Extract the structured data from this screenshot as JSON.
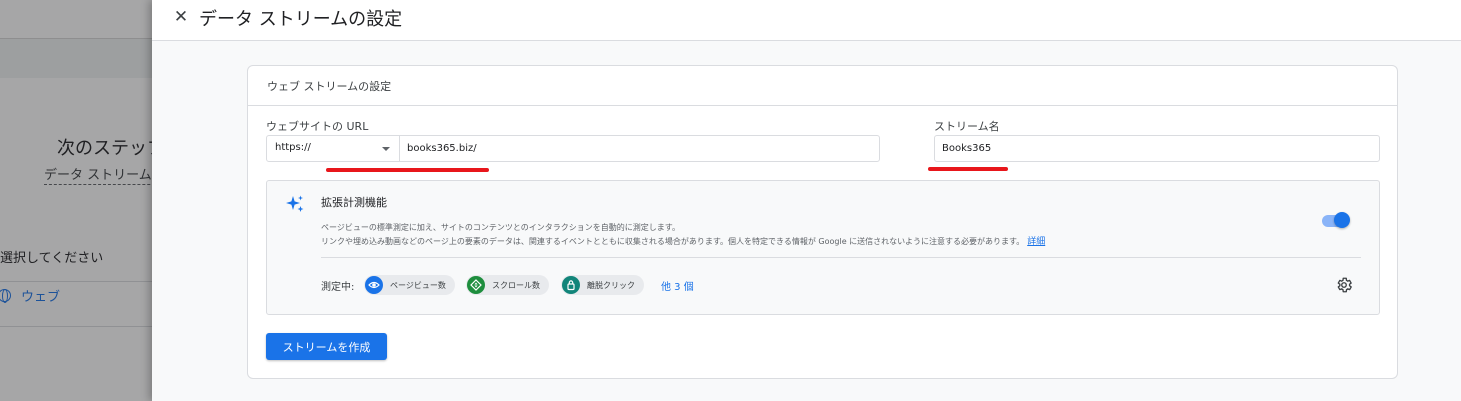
{
  "background": {
    "next_step": "次のステップ",
    "stream_prompt": "データ ストリームを",
    "select_prompt": "選択してください",
    "web_label": "ウェブ"
  },
  "drawer": {
    "close_glyph": "✕",
    "title": "データ ストリームの設定"
  },
  "card": {
    "title": "ウェブ ストリームの設定",
    "url_label": "ウェブサイトの URL",
    "protocol": "https://",
    "url_value": "books365.biz/",
    "stream_name_label": "ストリーム名",
    "stream_name_value": "Books365"
  },
  "enhanced": {
    "title": "拡張計測機能",
    "desc_line1": "ページビューの標準測定に加え、サイトのコンテンツとのインタラクションを自動的に測定します。",
    "desc_line2": "リンクや埋め込み動画などのページ上の要素のデータは、関連するイベントとともに収集される場合があります。個人を特定できる情報が Google に送信されないように注意する必要があります。",
    "detail_link": "詳細",
    "toggle_on": true,
    "measuring_label": "測定中:",
    "chips": [
      {
        "label": "ページビュー数",
        "icon": "eye-icon",
        "color": "#1a73e8"
      },
      {
        "label": "スクロール数",
        "icon": "scroll-icon",
        "color": "#1e8e3e"
      },
      {
        "label": "離脱クリック",
        "icon": "lock-icon",
        "color": "#12857a"
      }
    ],
    "more": "他 3 個"
  },
  "actions": {
    "create_label": "ストリームを作成"
  },
  "colors": {
    "accent": "#1a73e8",
    "annotation_red": "#e8161b"
  }
}
